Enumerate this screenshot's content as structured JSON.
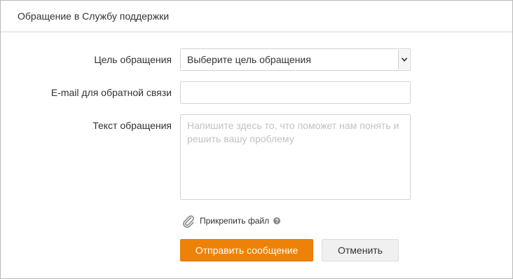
{
  "dialog": {
    "title": "Обращение в Службу поддержки"
  },
  "form": {
    "purpose_label": "Цель обращения",
    "purpose_selected": "Выберите цель обращения",
    "email_label": "E-mail для обратной связи",
    "email_value": "",
    "text_label": "Текст обращения",
    "text_placeholder": "Напишите здесь то, что поможет нам понять и решить вашу проблему",
    "attach_label": "Прикрепить файл",
    "help_glyph": "?"
  },
  "buttons": {
    "submit_label": "Отправить сообщение",
    "cancel_label": "Отменить"
  },
  "icons": {
    "attach": "paperclip-icon",
    "help": "help-icon",
    "dropdown": "chevron-down-icon"
  },
  "colors": {
    "primary": "#ee8208",
    "secondary_bg": "#f0f0f0"
  }
}
